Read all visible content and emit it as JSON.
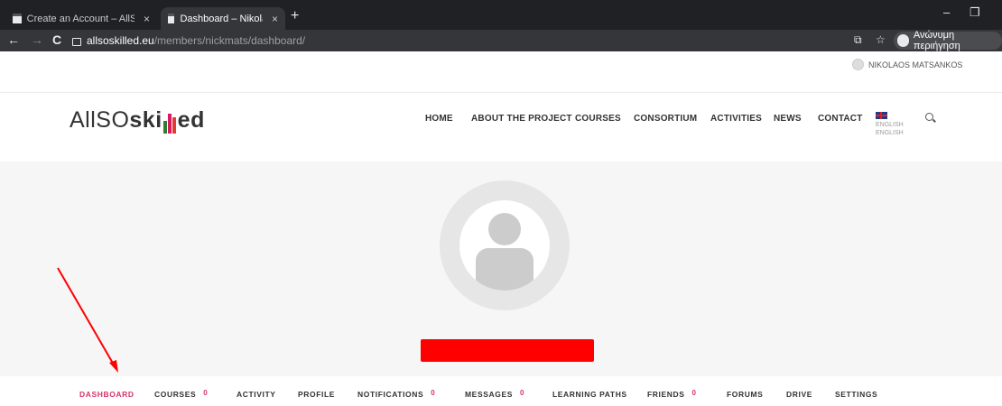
{
  "browser": {
    "tabs": [
      {
        "title": "Create an Account – AllSOskilled",
        "close": "×",
        "active": false
      },
      {
        "title": "Dashboard – Nikolaos Matsanko",
        "close": "×",
        "active": true
      }
    ],
    "new_tab": "+",
    "minimize": "–",
    "restore": "❐",
    "back_icon": "←",
    "forward_icon": "→",
    "reload_icon": "C",
    "url_host": "allsoskilled.eu",
    "url_path": "/members/nickmats/dashboard/",
    "translate_icon": "⧉",
    "star_icon": "☆",
    "incognito_label": "Ανώνυμη περιήγηση"
  },
  "site": {
    "user_name": "NIKOLAOS MATSANKOS",
    "logo": {
      "part1": "AllSO",
      "part2": "ski",
      "part3": "ed",
      "bar_colors": [
        "#2e7d32",
        "#d81b60",
        "#e53935"
      ]
    },
    "nav": [
      "HOME",
      "ABOUT THE PROJECT",
      "COURSES",
      "CONSORTIUM",
      "ACTIVITIES",
      "NEWS",
      "CONTACT"
    ],
    "language": {
      "line1": "ENGLISH",
      "line2": "ENGLISH"
    }
  },
  "profile_nav": {
    "dashboard": "DASHBOARD",
    "courses": "COURSES",
    "courses_count": "0",
    "activity": "ACTIVITY",
    "profile": "PROFILE",
    "notifications": "NOTIFICATIONS",
    "notifications_count": "0",
    "messages": "MESSAGES",
    "messages_count": "0",
    "learning_paths": "LEARNING PATHS",
    "friends": "FRIENDS",
    "friends_count": "0",
    "forums": "FORUMS",
    "drive": "DRIVE",
    "settings": "SETTINGS"
  },
  "annotation": {
    "color": "#ff0000"
  },
  "colors": {
    "accent": "#d6336c",
    "chrome_dark": "#202124",
    "chrome_toolbar": "#35363a"
  }
}
